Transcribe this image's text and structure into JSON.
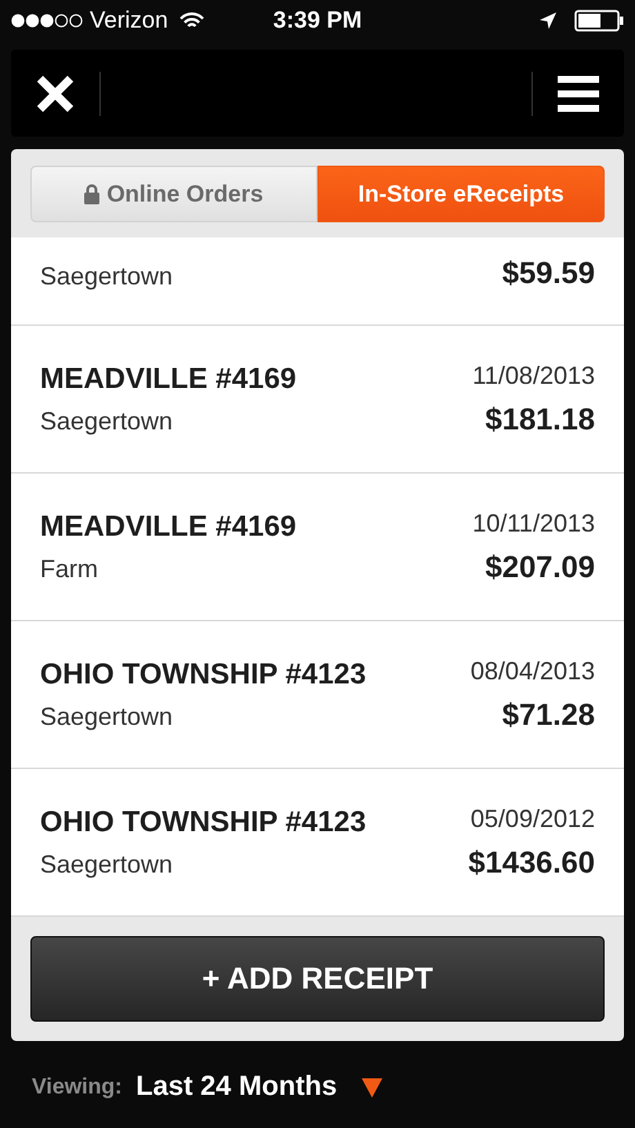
{
  "status_bar": {
    "carrier": "Verizon",
    "time": "3:39 PM"
  },
  "tabs": [
    {
      "label": "Online Orders",
      "selected": false,
      "locked": true
    },
    {
      "label": "In-Store eReceipts",
      "selected": true,
      "locked": false
    }
  ],
  "receipts": [
    {
      "kind": "partial",
      "location": "Saegertown",
      "amount": "$59.59"
    },
    {
      "kind": "full",
      "store": "MEADVILLE #4169",
      "date": "11/08/2013",
      "location": "Saegertown",
      "amount": "$181.18"
    },
    {
      "kind": "full",
      "store": "MEADVILLE #4169",
      "date": "10/11/2013",
      "location": "Farm",
      "amount": "$207.09"
    },
    {
      "kind": "full",
      "store": "OHIO TOWNSHIP #4123",
      "date": "08/04/2013",
      "location": "Saegertown",
      "amount": "$71.28"
    },
    {
      "kind": "full",
      "store": "OHIO TOWNSHIP #4123",
      "date": "05/09/2012",
      "location": "Saegertown",
      "amount": "$1436.60"
    }
  ],
  "add_button": "+ ADD RECEIPT",
  "viewing": {
    "label": "Viewing:",
    "value": "Last 24 Months"
  }
}
